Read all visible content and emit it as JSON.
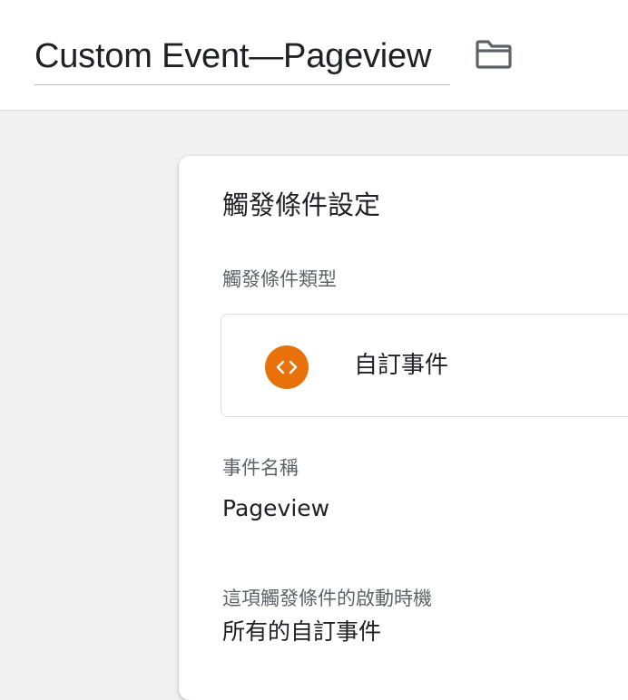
{
  "header": {
    "title": "Custom Event—Pageview",
    "folder_icon": "folder-icon"
  },
  "trigger_config": {
    "section_title": "觸發條件設定",
    "type_label": "觸發條件類型",
    "type": {
      "name": "自訂事件",
      "icon": "custom-event-code-icon",
      "icon_color": "#e8710a"
    },
    "event_name_label": "事件名稱",
    "event_name_value": "Pageview",
    "fires_on_label": "這項觸發條件的啟動時機",
    "fires_on_value": "所有的自訂事件"
  }
}
